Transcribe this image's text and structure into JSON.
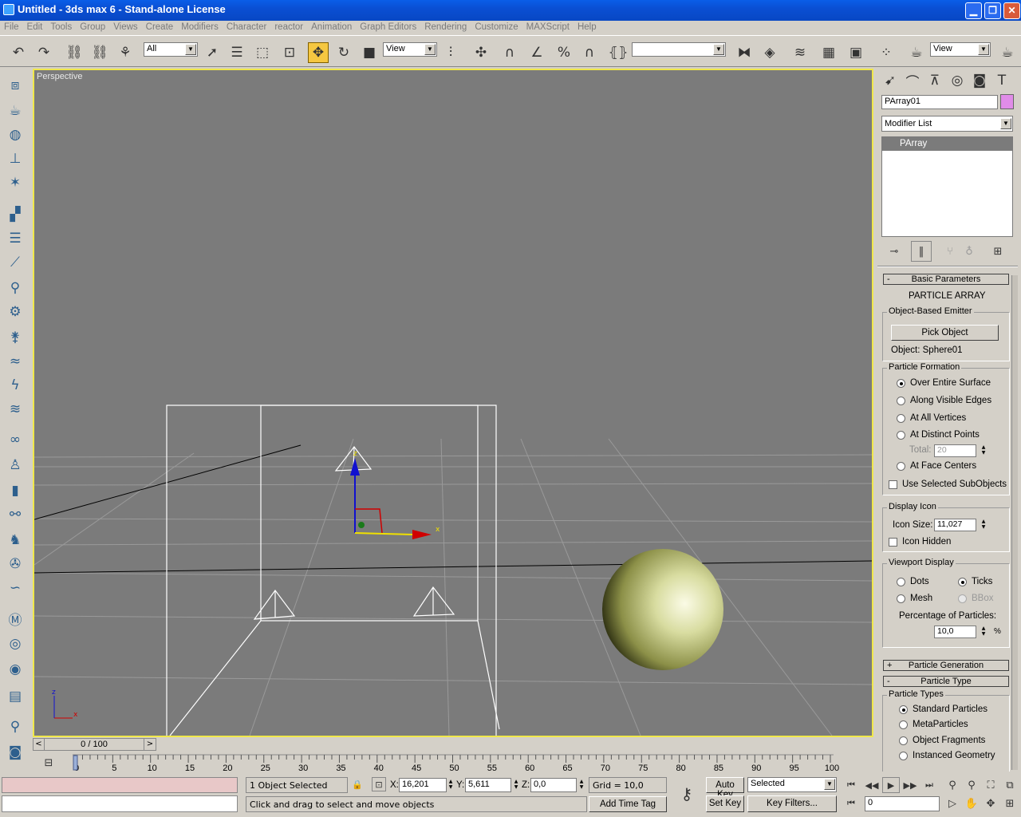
{
  "title": "Untitled - 3ds max 6 - Stand-alone License",
  "menu": [
    "File",
    "Edit",
    "Tools",
    "Group",
    "Views",
    "Create",
    "Modifiers",
    "Character",
    "reactor",
    "Animation",
    "Graph Editors",
    "Rendering",
    "Customize",
    "MAXScript",
    "Help"
  ],
  "toolbar": {
    "filter": "All",
    "refcoord": "View",
    "named_sel": "",
    "render_view": "View"
  },
  "viewport": {
    "label": "Perspective",
    "bg": "#7b7b7b",
    "border": "#f0e84a"
  },
  "panel": {
    "object_name": "PArray01",
    "object_color": "#e08ce8",
    "modifier_list": "Modifier List",
    "stack_item": "PArray",
    "basic_params": "Basic Parameters",
    "heading": "PARTICLE ARRAY",
    "emitter_group": "Object-Based Emitter",
    "pick_object": "Pick Object",
    "object_label": "Object: Sphere01",
    "formation_group": "Particle Formation",
    "formation": [
      "Over Entire Surface",
      "Along Visible Edges",
      "At All Vertices",
      "At Distinct Points"
    ],
    "total_label": "Total:",
    "total_value": "20",
    "face_centers": "At Face Centers",
    "use_selected": "Use Selected SubObjects",
    "display_icon_group": "Display Icon",
    "icon_size_label": "Icon Size:",
    "icon_size": "11,027",
    "icon_hidden": "Icon Hidden",
    "viewport_display_group": "Viewport Display",
    "vd_dots": "Dots",
    "vd_ticks": "Ticks",
    "vd_mesh": "Mesh",
    "vd_bbox": "BBox",
    "percentage_label": "Percentage of Particles:",
    "percentage": "10,0",
    "percent_sign": "%",
    "particle_generation": "Particle Generation",
    "particle_type": "Particle Type",
    "particle_types_group": "Particle Types",
    "types": [
      "Standard Particles",
      "MetaParticles",
      "Object Fragments",
      "Instanced Geometry"
    ]
  },
  "timeline": {
    "frame": "0 / 100",
    "ticks": [
      "0",
      "5",
      "10",
      "15",
      "20",
      "25",
      "30",
      "35",
      "40",
      "45",
      "50",
      "55",
      "60",
      "65",
      "70",
      "75",
      "80",
      "85",
      "90",
      "95",
      "100"
    ]
  },
  "status": {
    "selected": "1 Object Selected",
    "prompt": "Click and drag to select and move objects",
    "x": "16,201",
    "y": "5,611",
    "z": "0,0",
    "grid": "Grid = 10,0",
    "add_time_tag": "Add Time Tag",
    "auto_key": "Auto Key",
    "set_key": "Set Key",
    "key_mode": "Selected",
    "key_filters": "Key Filters...",
    "current_frame": "0",
    "x_label": "X:",
    "y_label": "Y:",
    "z_label": "Z:"
  }
}
